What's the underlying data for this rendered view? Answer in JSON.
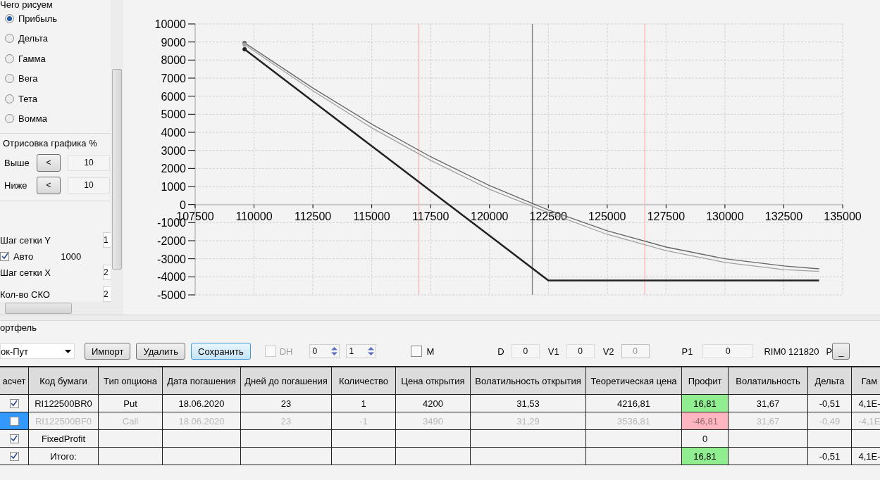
{
  "left_panel": {
    "draw_group": {
      "label": "Чего рисуем",
      "options": [
        {
          "label": "Прибыль",
          "selected": true
        },
        {
          "label": "Дельта",
          "selected": false
        },
        {
          "label": "Гамма",
          "selected": false
        },
        {
          "label": "Вега",
          "selected": false
        },
        {
          "label": "Тета",
          "selected": false
        },
        {
          "label": "Вомма",
          "selected": false
        }
      ]
    },
    "range_group": {
      "label": "Отрисовка графика %",
      "rows": [
        {
          "label": "Выше",
          "button": "<",
          "value": "10"
        },
        {
          "label": "Ниже",
          "button": "<",
          "value": "10"
        }
      ]
    },
    "grid": {
      "y_step_label": "Шаг сетки Y",
      "y_step_value": "1",
      "auto": {
        "label": "Авто",
        "checked": true,
        "value": "1000"
      },
      "x_step_label": "Шаг сетки X",
      "x_step_value": "2",
      "sko_label": "Кол-во СКО",
      "sko_value": "2"
    }
  },
  "chart": {
    "chart_data": {
      "type": "line",
      "grid": true,
      "x": [
        109600,
        112500,
        115000,
        117500,
        120000,
        122500,
        125000,
        127500,
        130000,
        132500,
        134000
      ],
      "series": [
        {
          "color": "#222222",
          "values": [
            8600,
            5720,
            3240,
            760,
            -1720,
            -4200,
            -4200,
            -4200,
            -4200,
            -4200,
            -4200
          ]
        },
        {
          "color": "#666666",
          "values": [
            8950,
            6450,
            4450,
            2650,
            1050,
            -300,
            -1450,
            -2350,
            -3000,
            -3400,
            -3560
          ]
        },
        {
          "color": "#a0a0a0",
          "values": [
            8850,
            6300,
            4250,
            2450,
            850,
            -450,
            -1650,
            -2550,
            -3200,
            -3600,
            -3700
          ]
        }
      ],
      "xlim": [
        107500,
        135000
      ],
      "ylim": [
        -5000,
        10000
      ],
      "xticks": [
        107500,
        110000,
        112500,
        115000,
        117500,
        120000,
        122500,
        125000,
        127500,
        130000,
        132500,
        135000
      ],
      "yticks": [
        -5000,
        -4000,
        -3000,
        -2000,
        -1000,
        0,
        1000,
        2000,
        3000,
        4000,
        5000,
        6000,
        7000,
        8000,
        9000,
        10000
      ],
      "ref_lines": [
        {
          "axis": "x",
          "value": 117000,
          "color": "#ffb0b8"
        },
        {
          "axis": "x",
          "value": 121820,
          "color": "#808080"
        },
        {
          "axis": "x",
          "value": 126600,
          "color": "#ffb0b8"
        }
      ]
    }
  },
  "portfolio": {
    "label": "ортфель",
    "strategy": "ок-Пут",
    "buttons": [
      {
        "label": "Импорт",
        "focused": false
      },
      {
        "label": "Удалить",
        "focused": false
      },
      {
        "label": "Сохранить",
        "focused": true
      }
    ],
    "dh": {
      "label": "DH",
      "checked": false,
      "disabled": true
    },
    "spinners": [
      "0",
      "1"
    ],
    "m": {
      "label": "M",
      "checked": false
    },
    "fields": [
      {
        "label": "D",
        "value": "0",
        "disabled": false
      },
      {
        "label": "V1",
        "value": "0",
        "disabled": false
      },
      {
        "label": "V2",
        "value": "0",
        "disabled": true
      },
      {
        "label": "P1",
        "value": "0",
        "disabled": false
      }
    ],
    "rim": "RIM0 121820",
    "p": {
      "label": "P",
      "button": "_"
    }
  },
  "table": {
    "columns": [
      "асчет",
      "Код бумаги",
      "Тип опциона",
      "Дата погашения",
      "Дней до погашения",
      "Количество",
      "Цена открытия",
      "Волатильность открытия",
      "Теоретическая цена",
      "Профит",
      "Волатильность",
      "Дельта",
      "Гам"
    ],
    "rows": [
      {
        "checked": true,
        "disabled": false,
        "selected": false,
        "color": "#90ee90",
        "cells": [
          "",
          "RI122500BR0",
          "Put",
          "18.06.2020",
          "23",
          "1",
          "4200",
          "31,53",
          "4216,81",
          "16,81",
          "31,67",
          "-0,51",
          "4,1E-"
        ]
      },
      {
        "checked": false,
        "disabled": true,
        "selected": true,
        "color": "#ffb6c1",
        "cells": [
          "",
          "RI122500BF0",
          "Call",
          "18.06.2020",
          "23",
          "-1",
          "3490",
          "31,29",
          "3536,81",
          "-46,81",
          "31,67",
          "-0,49",
          "-4,1E"
        ]
      },
      {
        "checked": true,
        "disabled": false,
        "selected": false,
        "cells": [
          "",
          "FixedProfit",
          "",
          "",
          "",
          "",
          "",
          "",
          "",
          "0",
          "",
          "",
          ""
        ]
      },
      {
        "checked": true,
        "disabled": false,
        "selected": false,
        "color": "#90ee90",
        "cells": [
          "",
          "Итого:",
          "",
          "",
          "",
          "",
          "",
          "",
          "",
          "16,81",
          "",
          "-0,51",
          "4,1E-"
        ]
      }
    ]
  }
}
